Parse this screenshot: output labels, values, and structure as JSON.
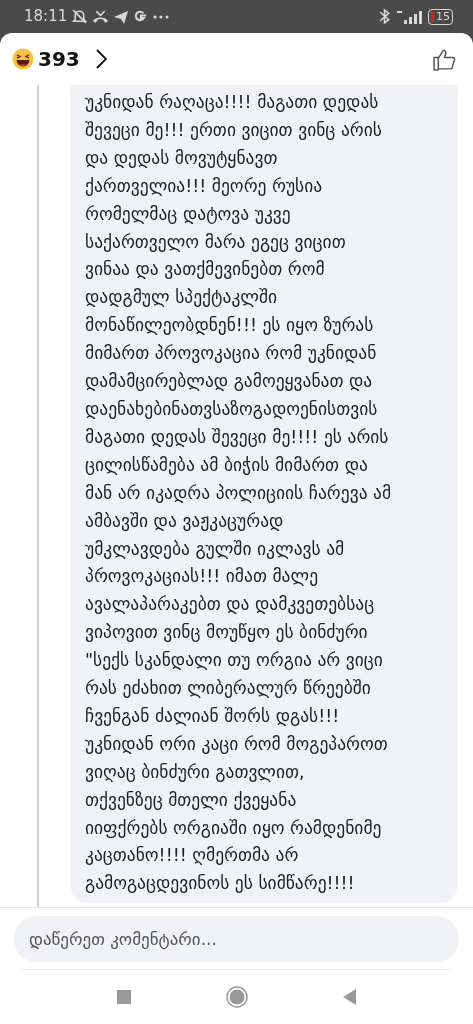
{
  "status_bar": {
    "time": "18:11",
    "battery": "15"
  },
  "header": {
    "reaction_count": "393"
  },
  "comment": {
    "text": "უკნიდან რაღაცა!!!! მაგათი დედას\nშევეცი მე!!! ერთი ვიცით ვინც არის\nდა დედას მოვუტყნავთ\nქართველია!!! მეორე რუსია\nრომელმაც დატოვა უკვე\nსაქართველო მარა ეგეც ვიცით\nვინაა და ვათქმევინებთ რომ\nდადგმულ სპექტაკლში\nმონაწილეობდნენ!!! ეს იყო ზურას\nმიმართ პროვოკაცია რომ უკნიდან\nდამამცირებლად გამოეყვანათ და\nდაენახებინათვსაზოგადოენისთვის\nმაგათი დედას შევეცი მე!!!! ეს არის\nცილისწამება ამ ბიჭის მიმართ და\nმან არ იკადრა პოლიციის ჩარევა ამ\nამბავში და ვაჟკაცურად\nუმკლავდება გულში იკლავს ამ\nპროვოკაციას!!! იმათ მალე\nავალაპარაკებთ და დამკვეთებსაც\nვიპოვით ვინც მოუწყო ეს ბინძური\n\"სექს სკანდალი თუ ორგია არ ვიცი\nრას ეძახით ლიბერალურ წრეებში\nჩვენგან ძალიან შორს დგას!!!\nუკნიდან ორი კაცი რომ მოგეპაროთ\nვიღაც ბინძური გათვლით,\nთქვენზეც მთელი ქვეყანა\nიიფქრებს ორგიაში იყო რამდენიმე\nკაცთანო!!!! ღმერთმა არ\nგამოგაცდევინოს ეს სიმწარე!!!!"
  },
  "comment_field": {
    "placeholder": "დაწერეთ კომენტარი..."
  }
}
